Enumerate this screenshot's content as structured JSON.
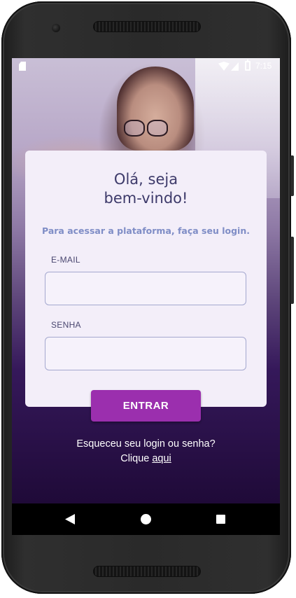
{
  "status_bar": {
    "time": "7:15",
    "icons": [
      "sd-card-icon",
      "wifi-icon",
      "signal-icon",
      "battery-icon"
    ]
  },
  "login": {
    "title_line1": "Olá, seja",
    "title_line2": "bem-vindo!",
    "subtitle": "Para acessar a plataforma, faça seu login.",
    "email_label": "E-MAIL",
    "email_value": "",
    "password_label": "SENHA",
    "password_value": "",
    "enter_label": "ENTRAR",
    "forgot_text": "Esqueceu seu login ou senha?",
    "click_text": "Clique",
    "here_link": "aqui"
  },
  "nav_bar": {
    "icons": [
      "back-icon",
      "home-icon",
      "recents-icon"
    ]
  },
  "colors": {
    "accent": "#9b2fae",
    "title": "#3d3a6a",
    "subtitle": "#7f8dc6",
    "card_bg": "#f3eef9",
    "screen_bottom": "#1b0730"
  }
}
